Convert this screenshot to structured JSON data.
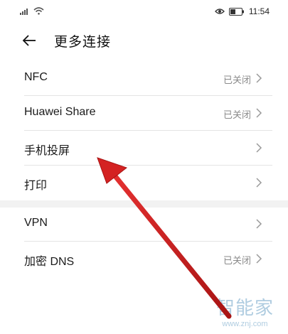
{
  "status_bar": {
    "time": "11:54",
    "icons": [
      "signal-icon",
      "wifi-icon",
      "eye-icon",
      "battery-icon"
    ]
  },
  "header": {
    "back_icon": "arrow-left-icon",
    "title": "更多连接"
  },
  "rows": [
    {
      "label": "NFC",
      "status": "已关闭",
      "chevron": "chevron-right-icon"
    },
    {
      "label": "Huawei Share",
      "status": "已关闭",
      "chevron": "chevron-right-icon"
    },
    {
      "label": "手机投屏",
      "status": "",
      "chevron": "chevron-right-icon"
    },
    {
      "label": "打印",
      "status": "",
      "chevron": "chevron-right-icon"
    },
    {
      "label": "VPN",
      "status": "",
      "chevron": "chevron-right-icon"
    },
    {
      "label": "加密 DNS",
      "status": "已关闭",
      "chevron": "chevron-right-icon"
    }
  ],
  "annotation": {
    "color": "#c81e1e",
    "icon": "red-arrow-annotation"
  },
  "watermark": {
    "brand": "智能家",
    "url": "www.znj.com",
    "color": "#6fa4c8"
  }
}
